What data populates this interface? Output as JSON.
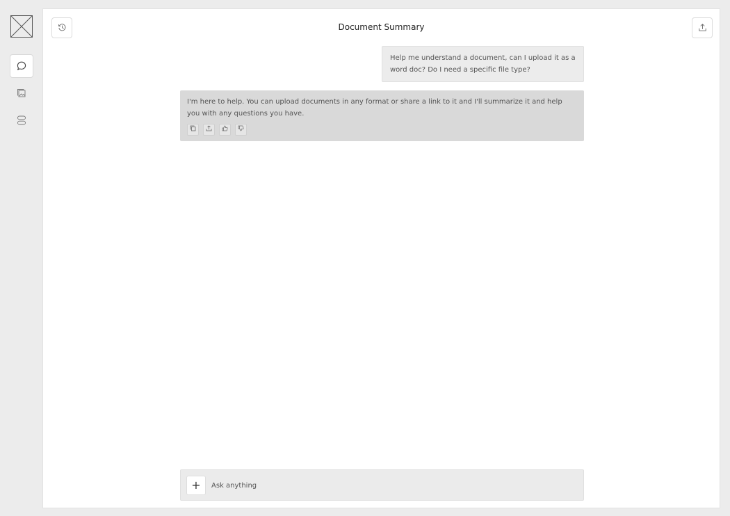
{
  "header": {
    "title": "Document Summary"
  },
  "messages": {
    "user": {
      "text": "Help me understand a document, can I upload it as a word doc? Do I need a specific file type?"
    },
    "assistant": {
      "text": "I'm here to help. You can upload documents in any format or share a link to it and I'll summarize it and help you with any questions you have."
    }
  },
  "composer": {
    "placeholder": "Ask anything",
    "value": "",
    "add_label": "+"
  },
  "icons": {
    "logo": "image-placeholder-icon",
    "rail": [
      "chat-bubble-icon",
      "image-gallery-icon",
      "server-stack-icon"
    ],
    "history": "history-clock-icon",
    "share": "upload-share-icon",
    "message_actions": [
      "copy-icon",
      "share-icon",
      "thumbs-up-icon",
      "thumbs-down-icon"
    ]
  },
  "colors": {
    "background": "#ececec",
    "panel": "#ffffff",
    "user_bubble": "#ececec",
    "assistant_bubble": "#d9d9d9"
  }
}
